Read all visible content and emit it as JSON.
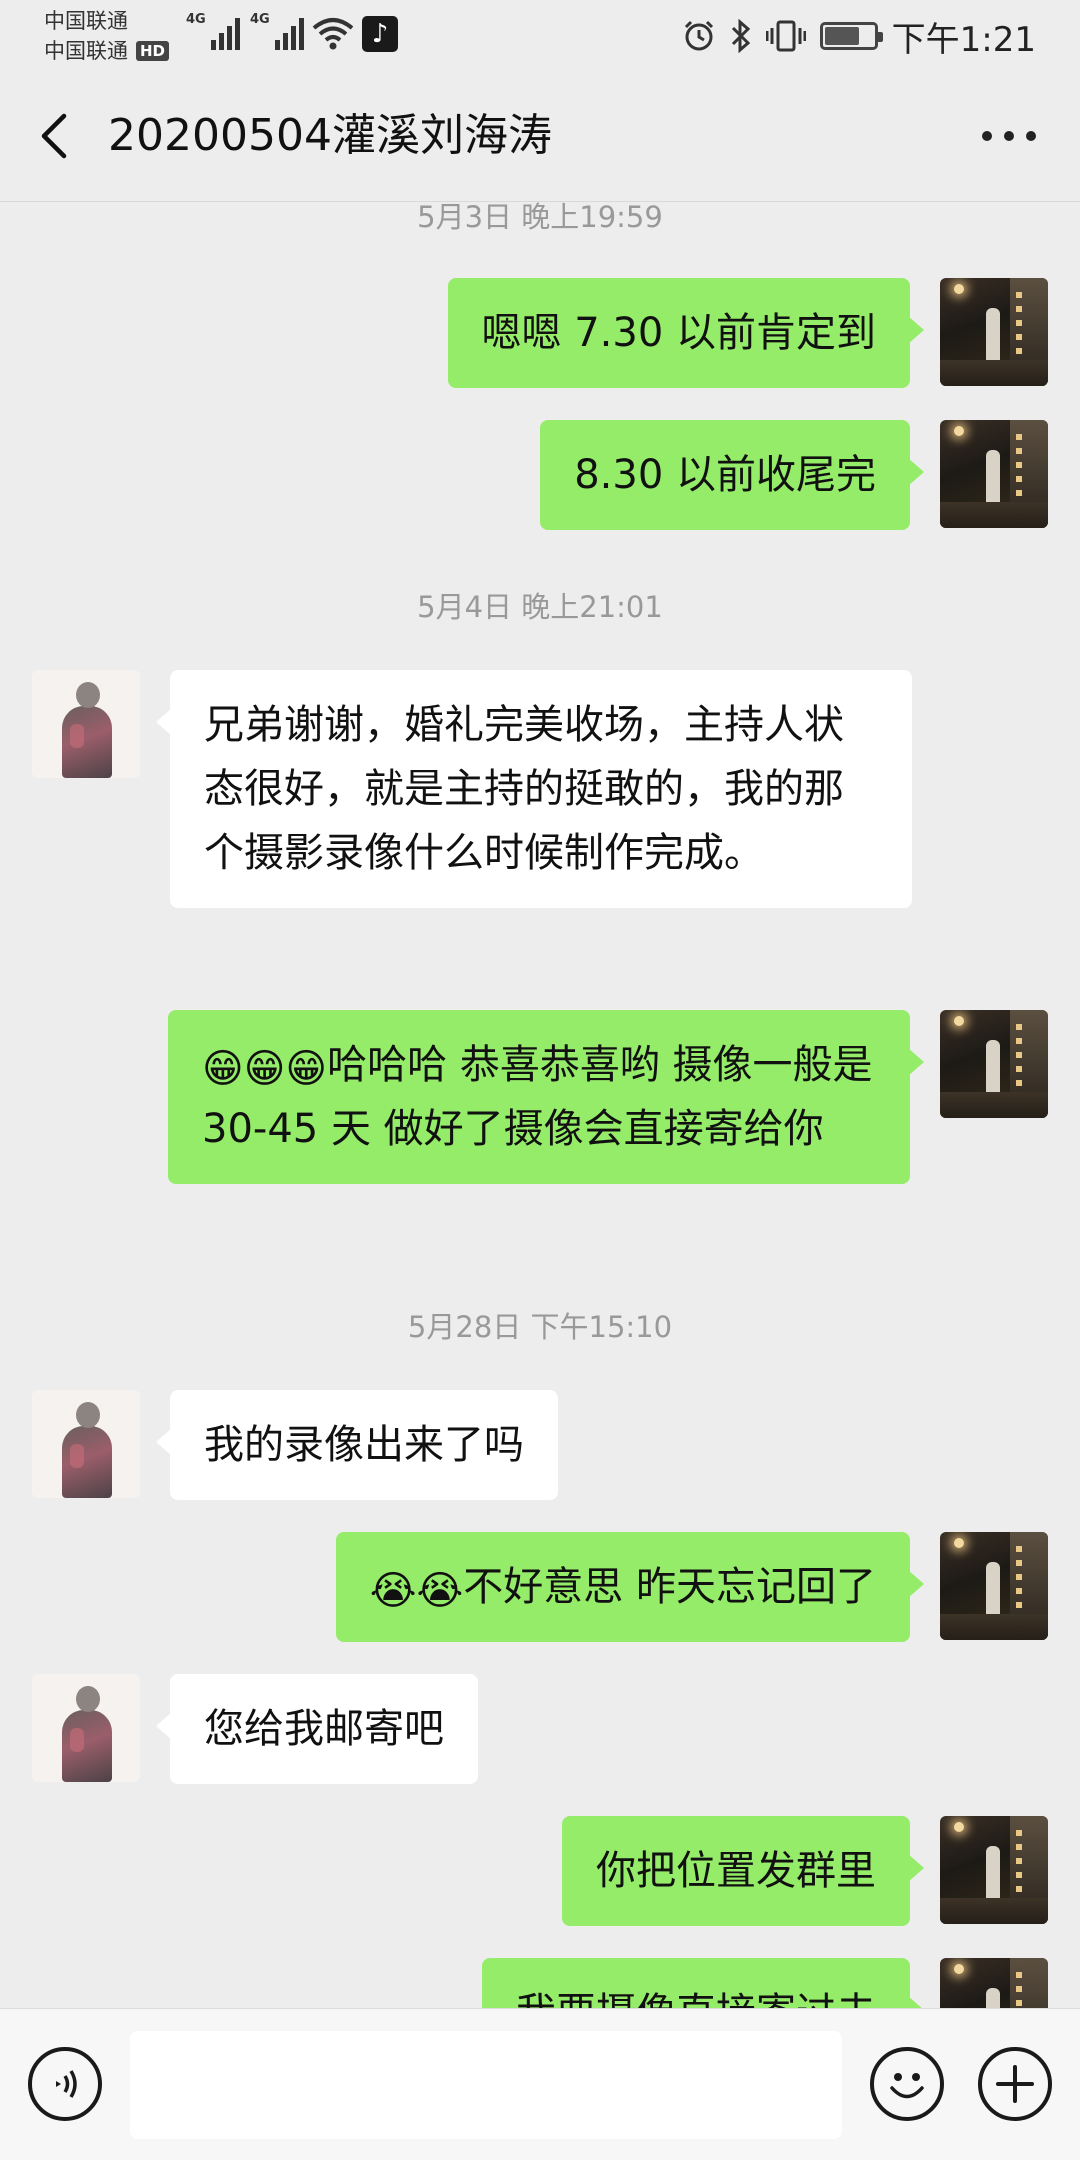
{
  "statusbar": {
    "carrier1": "中国联通",
    "carrier2": "中国联通",
    "hd_badge": "HD",
    "net1": "4G",
    "net2": "4G",
    "time": "下午1:21",
    "battery_level": 0.66
  },
  "header": {
    "title": "20200504灌溪刘海涛"
  },
  "chat": {
    "timestamps": [
      "5月3日 晚上19:59",
      "5月4日 晚上21:01",
      "5月28日 下午15:10"
    ],
    "messages": [
      {
        "from": "me",
        "text": "嗯嗯  7.30 以前肯定到"
      },
      {
        "from": "me",
        "text": "8.30 以前收尾完"
      },
      {
        "from": "other",
        "text": "兄弟谢谢，婚礼完美收场，主持人状态很好，就是主持的挺敢的，我的那个摄影录像什么时候制作完成。"
      },
      {
        "from": "me",
        "emoji": "😁😁😁",
        "text": "哈哈哈  恭喜恭喜哟  摄像一般是 30-45 天  做好了摄像会直接寄给你"
      },
      {
        "from": "other",
        "text": "我的录像出来了吗"
      },
      {
        "from": "me",
        "emoji": "😭😭",
        "text": "不好意思  昨天忘记回了"
      },
      {
        "from": "other",
        "text": "您给我邮寄吧"
      },
      {
        "from": "me",
        "text": "你把位置发群里"
      },
      {
        "from": "me",
        "text": "我要摄像直接寄过去"
      }
    ]
  },
  "input": {
    "value": ""
  },
  "colors": {
    "my_bubble": "#95ec69",
    "their_bubble": "#ffffff",
    "background": "#ededed"
  },
  "icons": [
    "back-arrow-icon",
    "more-icon",
    "voice-icon",
    "emoji-icon",
    "plus-icon",
    "alarm-icon",
    "bluetooth-icon",
    "vibrate-icon",
    "battery-icon",
    "wifi-icon",
    "tiktok-icon"
  ]
}
